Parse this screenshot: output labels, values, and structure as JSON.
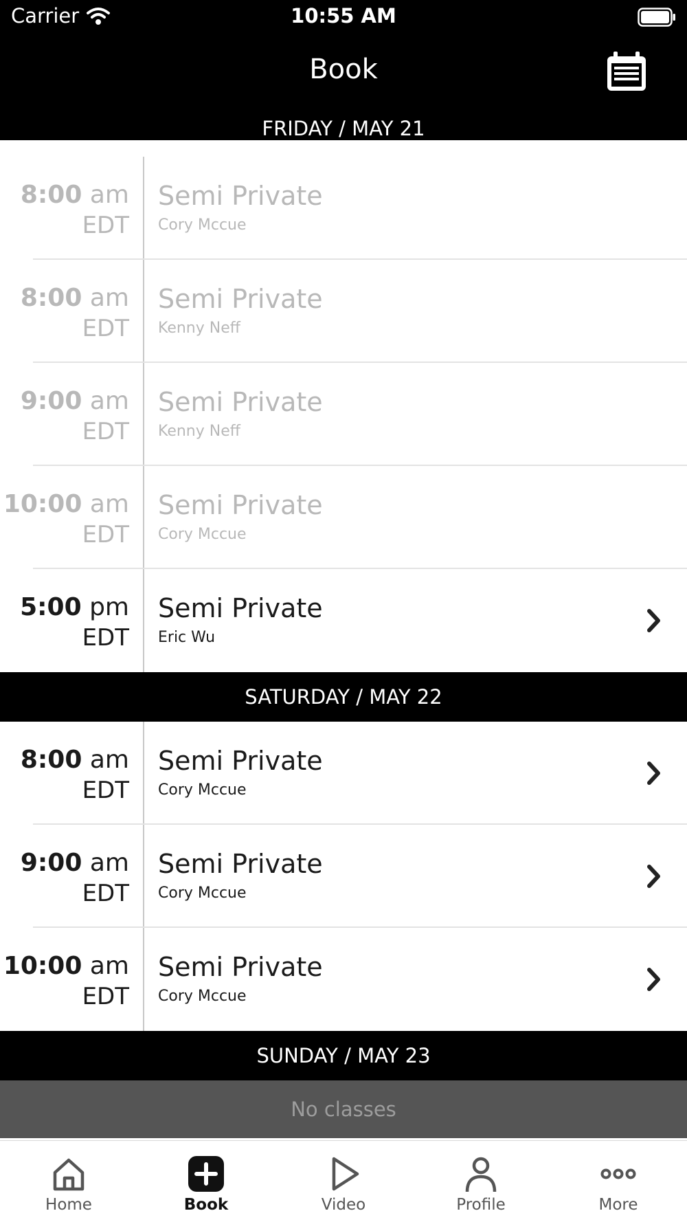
{
  "status_bar": {
    "carrier": "Carrier",
    "time": "10:55 AM"
  },
  "header": {
    "title": "Book",
    "calendar_icon": "calendar-icon"
  },
  "days": [
    {
      "label": "FRIDAY / MAY 21",
      "classes": [
        {
          "time": "8:00",
          "meridiem": "am",
          "tz": "EDT",
          "name": "Semi Private",
          "instructor": "Cory Mccue",
          "past": true
        },
        {
          "time": "8:00",
          "meridiem": "am",
          "tz": "EDT",
          "name": "Semi Private",
          "instructor": "Kenny Neff",
          "past": true
        },
        {
          "time": "9:00",
          "meridiem": "am",
          "tz": "EDT",
          "name": "Semi Private",
          "instructor": "Kenny Neff",
          "past": true
        },
        {
          "time": "10:00",
          "meridiem": "am",
          "tz": "EDT",
          "name": "Semi Private",
          "instructor": "Cory Mccue",
          "past": true
        },
        {
          "time": "5:00",
          "meridiem": "pm",
          "tz": "EDT",
          "name": "Semi Private",
          "instructor": "Eric Wu",
          "past": false
        }
      ]
    },
    {
      "label": "SATURDAY / MAY 22",
      "classes": [
        {
          "time": "8:00",
          "meridiem": "am",
          "tz": "EDT",
          "name": "Semi Private",
          "instructor": "Cory Mccue",
          "past": false
        },
        {
          "time": "9:00",
          "meridiem": "am",
          "tz": "EDT",
          "name": "Semi Private",
          "instructor": "Cory Mccue",
          "past": false
        },
        {
          "time": "10:00",
          "meridiem": "am",
          "tz": "EDT",
          "name": "Semi Private",
          "instructor": "Cory Mccue",
          "past": false
        }
      ]
    },
    {
      "label": "SUNDAY / MAY 23",
      "empty_text": "No classes",
      "classes": []
    }
  ],
  "tabs": [
    {
      "label": "Home",
      "icon": "home-icon",
      "active": false
    },
    {
      "label": "Book",
      "icon": "plus-icon",
      "active": true
    },
    {
      "label": "Video",
      "icon": "play-icon",
      "active": false
    },
    {
      "label": "Profile",
      "icon": "person-icon",
      "active": false
    },
    {
      "label": "More",
      "icon": "more-icon",
      "active": false
    }
  ]
}
